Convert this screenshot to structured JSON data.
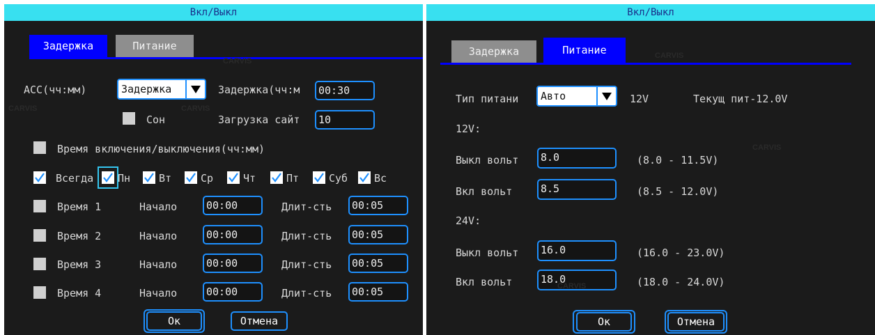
{
  "colors": {
    "title_bar": "#38e0f0",
    "tab_active": "#0000ff",
    "tab_inactive": "#8e8e8e",
    "field_border": "#1e90ff",
    "panel_bg": "#1b1b1b"
  },
  "watermark": "CARVIS",
  "left": {
    "title": "Вкл/Выкл",
    "tabs": {
      "delay": "Задержка",
      "power": "Питание"
    },
    "acc": {
      "label": "ACC(чч:мм)",
      "mode": "Задержка",
      "delay_label": "Задержка(чч:м",
      "delay_value": "00:30"
    },
    "sleep_label": "Сон",
    "upload": {
      "label": "Загрузка сайт",
      "value": "10"
    },
    "schedule_label": "Время включения/выключения(чч:мм)",
    "days": {
      "always": "Всегда",
      "mon": "Пн",
      "tue": "Вт",
      "wed": "Ср",
      "thu": "Чт",
      "fri": "Пт",
      "sat": "Суб",
      "sun": "Вс"
    },
    "times": [
      {
        "label": "Время 1",
        "start_label": "Начало",
        "start": "00:00",
        "dur_label": "Длит-сть",
        "dur": "00:05"
      },
      {
        "label": "Время 2",
        "start_label": "Начало",
        "start": "00:00",
        "dur_label": "Длит-сть",
        "dur": "00:05"
      },
      {
        "label": "Время 3",
        "start_label": "Начало",
        "start": "00:00",
        "dur_label": "Длит-сть",
        "dur": "00:05"
      },
      {
        "label": "Время 4",
        "start_label": "Начало",
        "start": "00:00",
        "dur_label": "Длит-сть",
        "dur": "00:05"
      }
    ],
    "ok": "Ок",
    "cancel": "Отмена"
  },
  "right": {
    "title": "Вкл/Выкл",
    "tabs": {
      "delay": "Задержка",
      "power": "Питание"
    },
    "power_type": {
      "label": "Тип питани",
      "value": "Авто",
      "voltage": "12V",
      "current": "Текущ пит-12.0V"
    },
    "v12": {
      "header": "12V:",
      "off_label": "Выкл вольт",
      "off_value": "8.0",
      "off_range": "(8.0 - 11.5V)",
      "on_label": "Вкл вольт",
      "on_value": "8.5",
      "on_range": "(8.5 - 12.0V)"
    },
    "v24": {
      "header": "24V:",
      "off_label": "Выкл вольт",
      "off_value": "16.0",
      "off_range": "(16.0 - 23.0V)",
      "on_label": "Вкл вольт",
      "on_value": "18.0",
      "on_range": "(18.0 - 24.0V)"
    },
    "ok": "Ок",
    "cancel": "Отмена"
  }
}
